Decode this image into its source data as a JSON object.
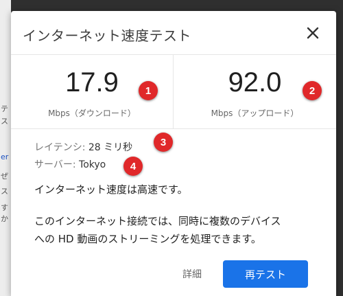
{
  "background": {
    "strip_fragments": [
      "テ",
      "ス",
      "er",
      "ぜ",
      "ス",
      "すか"
    ]
  },
  "dialog": {
    "title": "インターネット速度テスト",
    "close_icon": "close-icon",
    "download": {
      "value": "17.9",
      "unit": "Mbps（ダウンロード）",
      "badge": "1"
    },
    "upload": {
      "value": "92.0",
      "unit": "Mbps（アップロード）",
      "badge": "2"
    },
    "latency": {
      "label": "レイテンシ:",
      "value": "28 ミリ秒",
      "badge": "3"
    },
    "server": {
      "label": "サーバー:",
      "value": "Tokyo",
      "badge": "4"
    },
    "status_text": "インターネット速度は高速です。",
    "description_line1": "このインターネット接続では、同時に複数のデバイス",
    "description_line2": "への HD 動画のストリーミングを処理できます。",
    "details_label": "詳細",
    "retest_label": "再テスト"
  },
  "colors": {
    "accent": "#1a73e8",
    "badge": "#e0282a"
  }
}
